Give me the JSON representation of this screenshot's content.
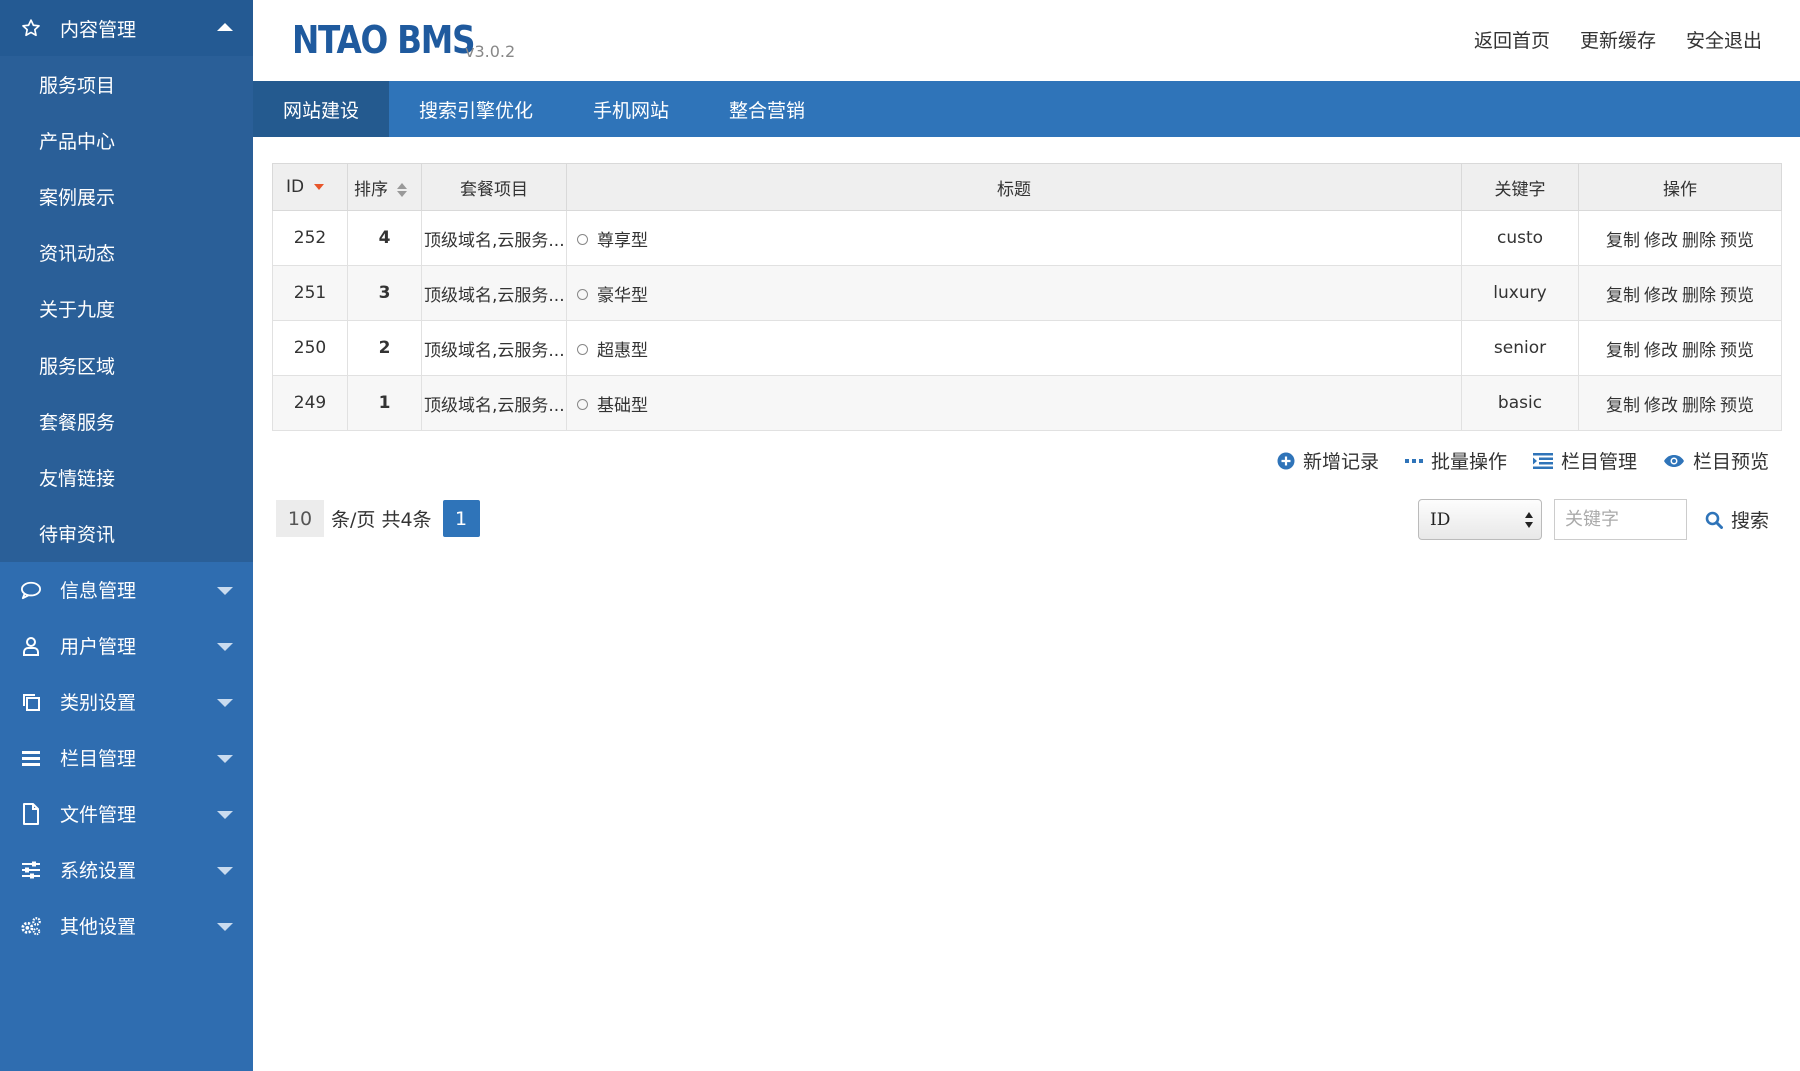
{
  "sidebar": {
    "open_menu": {
      "label": "内容管理",
      "icon": "star-icon"
    },
    "sub_items": [
      "服务项目",
      "产品中心",
      "案例展示",
      "资讯动态",
      "关于九度",
      "服务区域",
      "套餐服务",
      "友情链接",
      "待审资讯"
    ],
    "menus": [
      {
        "label": "信息管理",
        "icon": "chat-bubble-icon"
      },
      {
        "label": "用户管理",
        "icon": "user-icon"
      },
      {
        "label": "类别设置",
        "icon": "copy-icon"
      },
      {
        "label": "栏目管理",
        "icon": "list-icon"
      },
      {
        "label": "文件管理",
        "icon": "file-icon"
      },
      {
        "label": "系统设置",
        "icon": "sliders-icon"
      },
      {
        "label": "其他设置",
        "icon": "gears-icon"
      }
    ]
  },
  "header": {
    "logo": "NTAO BMS",
    "version": "v3.0.2",
    "links": [
      "返回首页",
      "更新缓存",
      "安全退出"
    ]
  },
  "tabs": [
    "网站建设",
    "搜索引擎优化",
    "手机网站",
    "整合营销"
  ],
  "table": {
    "columns": [
      "ID",
      "排序",
      "套餐项目",
      "标题",
      "关键字",
      "操作"
    ],
    "rows": [
      {
        "id": "252",
        "sort": "4",
        "package": "顶级域名,云服务...",
        "title": "尊享型",
        "keyword": "custo"
      },
      {
        "id": "251",
        "sort": "3",
        "package": "顶级域名,云服务...",
        "title": "豪华型",
        "keyword": "luxury"
      },
      {
        "id": "250",
        "sort": "2",
        "package": "顶级域名,云服务...",
        "title": "超惠型",
        "keyword": "senior"
      },
      {
        "id": "249",
        "sort": "1",
        "package": "顶级域名,云服务...",
        "title": "基础型",
        "keyword": "basic"
      }
    ],
    "row_ops": [
      "复制",
      "修改",
      "删除",
      "预览"
    ]
  },
  "actions": [
    {
      "label": "新增记录",
      "icon": "plus-circle-icon"
    },
    {
      "label": "批量操作",
      "icon": "ellipsis-icon"
    },
    {
      "label": "栏目管理",
      "icon": "list-indent-icon"
    },
    {
      "label": "栏目预览",
      "icon": "eye-icon"
    }
  ],
  "pager": {
    "page_size": "10",
    "summary": "条/页 共4条",
    "current_page": "1"
  },
  "search": {
    "field": "ID",
    "placeholder": "关键字",
    "button": "搜索"
  },
  "colors": {
    "sidebar": "#2f6db0",
    "tabbar": "#2f74b9",
    "accent": "#2f74b9",
    "logo": "#1f5a9e"
  }
}
